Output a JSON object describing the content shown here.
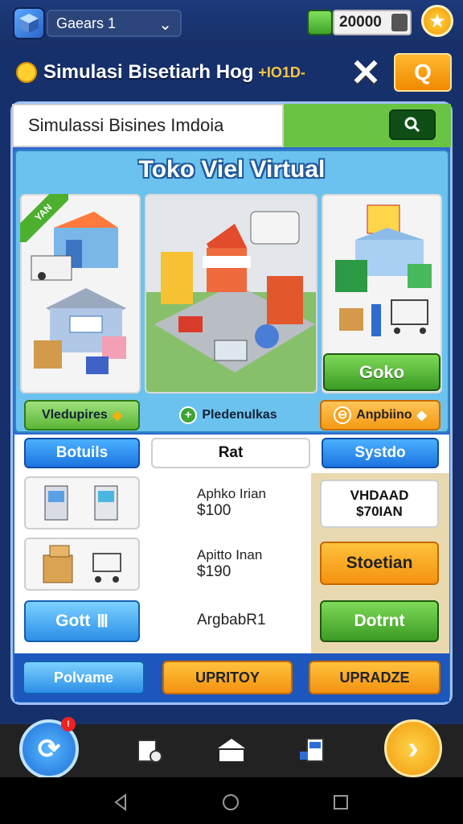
{
  "header": {
    "profile_label": "Gaears 1",
    "currency_amount": "20000"
  },
  "title_bar": {
    "title": "Simulasi Bisetiarh Hog",
    "suffix": "+IO1D-",
    "close_label": "✕",
    "action_label": "Q"
  },
  "search": {
    "value": "Simulassi Bisines Imdoia"
  },
  "shop": {
    "title": "Toko Viel Virtual",
    "ribbon": "YAN",
    "right_button": "Goko",
    "pills": [
      "Vledupires",
      "Pledenulkas",
      "Anpbiino"
    ]
  },
  "tabs": [
    "Botuils",
    "Rat",
    "Systdo"
  ],
  "price_items": [
    {
      "name": "Aphko Irian",
      "price": "$100"
    },
    {
      "name": "Apitto Inan",
      "price": "$190"
    }
  ],
  "middle_label": "ArgbabR1",
  "right_panel": {
    "head_line1": "VHDAAD",
    "head_line2": "$70IAN",
    "orange_button": "Stoetian",
    "green_button": "Dotrnt"
  },
  "left_button": "Gott",
  "left_button_glyph": "Ⅲ",
  "footer_buttons": [
    "Polvame",
    "UPRITOY",
    "UPRADZE"
  ],
  "nav": {
    "notification_count": "!"
  },
  "colors": {
    "primary_blue": "#2f6ad0",
    "accent_orange": "#f39210",
    "accent_green": "#3b9b24",
    "sky": "#6cc2ef"
  }
}
